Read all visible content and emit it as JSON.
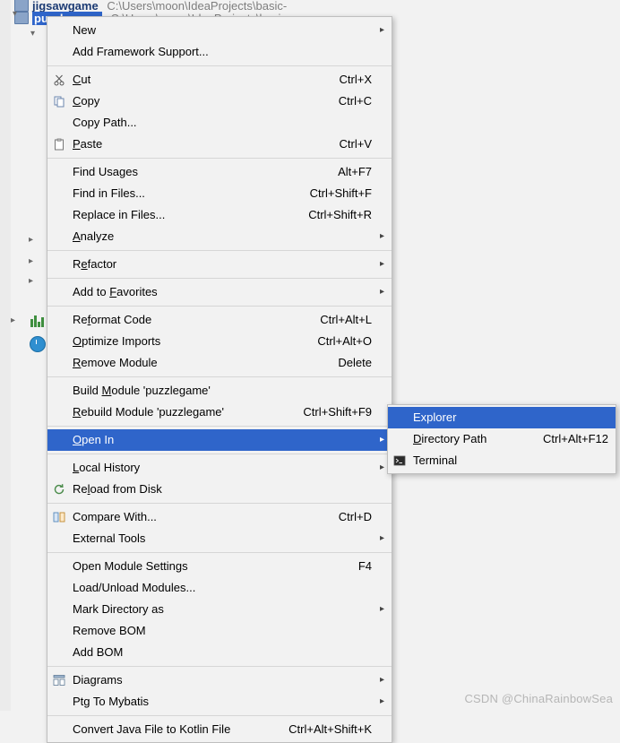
{
  "window": {
    "watermark": "CSDN @ChinaRainbowSea"
  },
  "project_tree": {
    "row_top": {
      "label": "jigsawgame",
      "path": "C:\\Users\\moon\\IdeaProjects\\basic-"
    },
    "row_selected": {
      "label": "puzzlegame",
      "path": "C:\\Users\\moon\\IdeaProjects\\basic-"
    }
  },
  "context_menu": {
    "items": [
      {
        "label": "New",
        "accel": "",
        "arrow": true,
        "icon": "",
        "selected": false
      },
      {
        "label": "Add Framework Support...",
        "accel": "",
        "arrow": false,
        "icon": "",
        "selected": false
      },
      {
        "separator": true
      },
      {
        "label": "Cut",
        "accel": "Ctrl+X",
        "arrow": false,
        "icon": "scissors-icon",
        "selected": false
      },
      {
        "label": "Copy",
        "accel": "Ctrl+C",
        "arrow": false,
        "icon": "copy-icon",
        "selected": false
      },
      {
        "label": "Copy Path...",
        "accel": "",
        "arrow": false,
        "icon": "",
        "selected": false
      },
      {
        "label": "Paste",
        "accel": "Ctrl+V",
        "arrow": false,
        "icon": "clipboard-icon",
        "selected": false
      },
      {
        "separator": true
      },
      {
        "label": "Find Usages",
        "accel": "Alt+F7",
        "arrow": false,
        "icon": "",
        "selected": false
      },
      {
        "label": "Find in Files...",
        "accel": "Ctrl+Shift+F",
        "arrow": false,
        "icon": "",
        "selected": false
      },
      {
        "label": "Replace in Files...",
        "accel": "Ctrl+Shift+R",
        "arrow": false,
        "icon": "",
        "selected": false
      },
      {
        "label": "Analyze",
        "accel": "",
        "arrow": true,
        "icon": "",
        "selected": false
      },
      {
        "separator": true
      },
      {
        "label": "Refactor",
        "accel": "",
        "arrow": true,
        "icon": "",
        "selected": false
      },
      {
        "separator": true
      },
      {
        "label": "Add to Favorites",
        "accel": "",
        "arrow": true,
        "icon": "",
        "selected": false
      },
      {
        "separator": true
      },
      {
        "label": "Reformat Code",
        "accel": "Ctrl+Alt+L",
        "arrow": false,
        "icon": "",
        "selected": false
      },
      {
        "label": "Optimize Imports",
        "accel": "Ctrl+Alt+O",
        "arrow": false,
        "icon": "",
        "selected": false
      },
      {
        "label": "Remove Module",
        "accel": "Delete",
        "arrow": false,
        "icon": "",
        "selected": false
      },
      {
        "separator": true
      },
      {
        "label": "Build Module 'puzzlegame'",
        "accel": "",
        "arrow": false,
        "icon": "",
        "selected": false
      },
      {
        "label": "Rebuild Module 'puzzlegame'",
        "accel": "Ctrl+Shift+F9",
        "arrow": false,
        "icon": "",
        "selected": false
      },
      {
        "separator": true
      },
      {
        "label": "Open In",
        "accel": "",
        "arrow": true,
        "icon": "",
        "selected": true
      },
      {
        "separator": true
      },
      {
        "label": "Local History",
        "accel": "",
        "arrow": true,
        "icon": "",
        "selected": false
      },
      {
        "label": "Reload from Disk",
        "accel": "",
        "arrow": false,
        "icon": "refresh-icon",
        "selected": false
      },
      {
        "separator": true
      },
      {
        "label": "Compare With...",
        "accel": "Ctrl+D",
        "arrow": false,
        "icon": "compare-icon",
        "selected": false
      },
      {
        "label": "External Tools",
        "accel": "",
        "arrow": true,
        "icon": "",
        "selected": false
      },
      {
        "separator": true
      },
      {
        "label": "Open Module Settings",
        "accel": "F4",
        "arrow": false,
        "icon": "",
        "selected": false
      },
      {
        "label": "Load/Unload Modules...",
        "accel": "",
        "arrow": false,
        "icon": "",
        "selected": false
      },
      {
        "label": "Mark Directory as",
        "accel": "",
        "arrow": true,
        "icon": "",
        "selected": false
      },
      {
        "label": "Remove BOM",
        "accel": "",
        "arrow": false,
        "icon": "",
        "selected": false
      },
      {
        "label": "Add BOM",
        "accel": "",
        "arrow": false,
        "icon": "",
        "selected": false
      },
      {
        "separator": true
      },
      {
        "label": "Diagrams",
        "accel": "",
        "arrow": true,
        "icon": "diagram-icon",
        "selected": false
      },
      {
        "label": "Ptg To Mybatis",
        "accel": "",
        "arrow": true,
        "icon": "",
        "selected": false
      },
      {
        "separator": true
      },
      {
        "label": "Convert Java File to Kotlin File",
        "accel": "Ctrl+Alt+Shift+K",
        "arrow": false,
        "icon": "",
        "selected": false
      }
    ]
  },
  "sub_menu": {
    "items": [
      {
        "label": "Explorer",
        "accel": "",
        "icon": "",
        "selected": true
      },
      {
        "label": "Directory Path",
        "accel": "Ctrl+Alt+F12",
        "icon": "",
        "selected": false
      },
      {
        "label": "Terminal",
        "accel": "",
        "icon": "terminal-icon",
        "selected": false
      }
    ]
  }
}
